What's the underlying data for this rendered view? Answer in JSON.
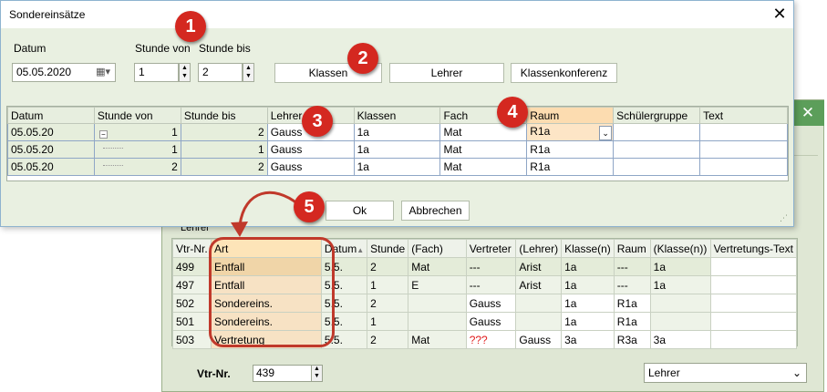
{
  "bg": {
    "close_glyph": "✕",
    "section_label": "Lehrer",
    "columns": [
      "Vtr-Nr.",
      "Art",
      "Datum",
      "Stunde",
      "(Fach)",
      "Vertreter",
      "(Lehrer)",
      "Klasse(n)",
      "Raum",
      "(Klasse(n))",
      "Vertretungs-Text"
    ],
    "rows": [
      [
        "499",
        "Entfall",
        "5.5.",
        "2",
        "Mat",
        "---",
        "Arist",
        "1a",
        "---",
        "1a",
        ""
      ],
      [
        "497",
        "Entfall",
        "5.5.",
        "1",
        "E",
        "---",
        "Arist",
        "1a",
        "---",
        "1a",
        ""
      ],
      [
        "502",
        "Sondereins.",
        "5.5.",
        "2",
        "",
        "Gauss",
        "",
        "1a",
        "R1a",
        "",
        ""
      ],
      [
        "501",
        "Sondereins.",
        "5.5.",
        "1",
        "",
        "Gauss",
        "",
        "1a",
        "R1a",
        "",
        ""
      ],
      [
        "503",
        "Vertretung",
        "5.5.",
        "2",
        "Mat",
        "???",
        "Gauss",
        "3a",
        "R3a",
        "3a",
        ""
      ]
    ],
    "vtr_label": "Vtr-Nr.",
    "vtr_value": "439",
    "select_value": "Lehrer"
  },
  "dialog": {
    "title": "Sondereinsätze",
    "close_glyph": "✕",
    "datum_label": "Datum",
    "datum_value": "05.05.2020",
    "stunde_von_label": "Stunde von",
    "stunde_von_value": "1",
    "stunde_bis_label": "Stunde bis",
    "stunde_bis_value": "2",
    "btn_klassen": "Klassen",
    "btn_lehrer": "Lehrer",
    "btn_klassenkonferenz": "Klassenkonferenz",
    "columns": [
      "Datum",
      "Stunde von",
      "Stunde bis",
      "Lehrer",
      "Klassen",
      "Fach",
      "Raum",
      "Schülergruppe",
      "Text"
    ],
    "rows": [
      {
        "datum": "05.05.20",
        "von": "1",
        "bis": "2",
        "lehrer": "Gauss",
        "klassen": "1a",
        "fach": "Mat",
        "raum": "R1a",
        "gruppe": "",
        "text": ""
      },
      {
        "datum": "05.05.20",
        "von": "1",
        "bis": "1",
        "lehrer": "Gauss",
        "klassen": "1a",
        "fach": "Mat",
        "raum": "R1a",
        "gruppe": "",
        "text": ""
      },
      {
        "datum": "05.05.20",
        "von": "2",
        "bis": "2",
        "lehrer": "Gauss",
        "klassen": "1a",
        "fach": "Mat",
        "raum": "R1a",
        "gruppe": "",
        "text": ""
      }
    ],
    "ok_label": "Ok",
    "cancel_label": "Abbrechen"
  },
  "annotations": [
    "1",
    "2",
    "3",
    "4",
    "5"
  ],
  "colors": {
    "badge": "#d42820",
    "highlight": "#c0392b",
    "selected_column": "#fcdcb0",
    "window_bg": "#e9f0e1"
  }
}
